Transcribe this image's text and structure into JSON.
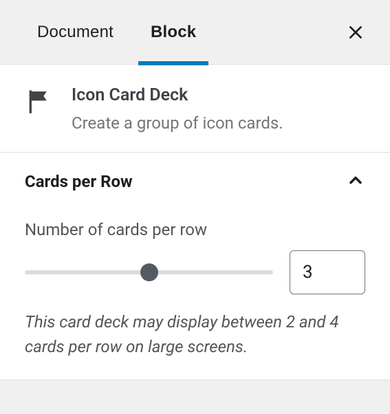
{
  "tabs": {
    "document": "Document",
    "block": "Block",
    "active": "block"
  },
  "block": {
    "title": "Icon Card Deck",
    "description": "Create a group of icon cards."
  },
  "section": {
    "title": "Cards per Row",
    "expanded": true,
    "field_label": "Number of cards per row",
    "value": "3",
    "min": 2,
    "max": 4,
    "help": "This card deck may display between 2 and 4 cards per row on large screens."
  }
}
